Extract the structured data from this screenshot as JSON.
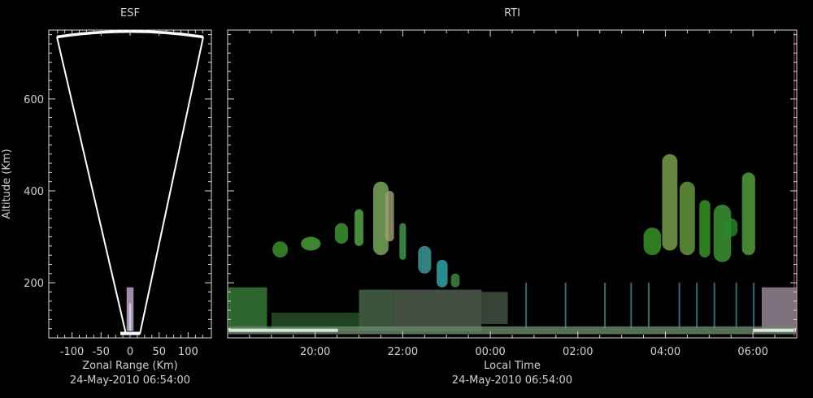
{
  "colors": {
    "background": "#000000",
    "axis": "#d8d8d8",
    "text": "#d0d0d0",
    "fan": "#ffffff",
    "right_edge": "#b06060"
  },
  "chart_data": [
    {
      "type": "scatter",
      "title": "ESF",
      "xlabel": "Zonal Range (Km)",
      "ylabel": "Altitude (Km)",
      "timestamp": "24-May-2010 06:54:00",
      "xlim": [
        -140,
        140
      ],
      "ylim": [
        80,
        750
      ],
      "x_ticks": [
        {
          "value": -100,
          "label": "-100"
        },
        {
          "value": -50,
          "label": "-50"
        },
        {
          "value": 0,
          "label": "0"
        },
        {
          "value": 50,
          "label": "50"
        },
        {
          "value": 100,
          "label": "100"
        }
      ],
      "y_ticks": [
        {
          "value": 200,
          "label": "200"
        },
        {
          "value": 400,
          "label": "400"
        },
        {
          "value": 600,
          "label": "600"
        }
      ],
      "beam_fan": {
        "apex": [
          0,
          88
        ],
        "left_edge": [
          -126,
          735
        ],
        "right_edge": [
          126,
          735
        ],
        "top_altitude": 745
      },
      "echo_column": {
        "x_range": [
          -6,
          6
        ],
        "y_range": [
          95,
          190
        ]
      }
    },
    {
      "type": "heatmap",
      "title": "RTI",
      "xlabel": "Local Time",
      "timestamp": "24-May-2010 06:54:00",
      "xlim": [
        18.0,
        31.0
      ],
      "ylim": [
        80,
        750
      ],
      "x_ticks": [
        {
          "value": 20,
          "label": "20:00"
        },
        {
          "value": 22,
          "label": "22:00"
        },
        {
          "value": 24,
          "label": "00:00"
        },
        {
          "value": 26,
          "label": "02:00"
        },
        {
          "value": 28,
          "label": "04:00"
        },
        {
          "value": 30,
          "label": "06:00"
        }
      ],
      "y_ticks": [
        200,
        400,
        600
      ],
      "plumes": [
        {
          "t": 19.2,
          "alt_low": 255,
          "alt_high": 290,
          "width": 0.35,
          "color": "#3a9a2a"
        },
        {
          "t": 19.9,
          "alt_low": 270,
          "alt_high": 300,
          "width": 0.45,
          "color": "#4aa83a"
        },
        {
          "t": 20.6,
          "alt_low": 285,
          "alt_high": 330,
          "width": 0.3,
          "color": "#3f9e35"
        },
        {
          "t": 21.0,
          "alt_low": 280,
          "alt_high": 360,
          "width": 0.2,
          "color": "#58b048"
        },
        {
          "t": 21.5,
          "alt_low": 260,
          "alt_high": 420,
          "width": 0.35,
          "color": "#7fb060"
        },
        {
          "t": 21.7,
          "alt_low": 290,
          "alt_high": 400,
          "width": 0.2,
          "color": "#a0a070"
        },
        {
          "t": 22.0,
          "alt_low": 250,
          "alt_high": 330,
          "width": 0.15,
          "color": "#40a050"
        },
        {
          "t": 22.5,
          "alt_low": 220,
          "alt_high": 280,
          "width": 0.3,
          "color": "#40a0a0"
        },
        {
          "t": 22.9,
          "alt_low": 190,
          "alt_high": 250,
          "width": 0.25,
          "color": "#30b0b0"
        },
        {
          "t": 23.2,
          "alt_low": 190,
          "alt_high": 220,
          "width": 0.2,
          "color": "#409040"
        },
        {
          "t": 27.7,
          "alt_low": 260,
          "alt_high": 320,
          "width": 0.4,
          "color": "#3a9a2a"
        },
        {
          "t": 28.1,
          "alt_low": 270,
          "alt_high": 480,
          "width": 0.35,
          "color": "#7fa850"
        },
        {
          "t": 28.5,
          "alt_low": 260,
          "alt_high": 420,
          "width": 0.35,
          "color": "#6aa040"
        },
        {
          "t": 28.9,
          "alt_low": 255,
          "alt_high": 380,
          "width": 0.25,
          "color": "#3a9a2a"
        },
        {
          "t": 29.3,
          "alt_low": 245,
          "alt_high": 370,
          "width": 0.4,
          "color": "#3f9e35"
        },
        {
          "t": 29.9,
          "alt_low": 260,
          "alt_high": 440,
          "width": 0.3,
          "color": "#58a840"
        },
        {
          "t": 29.5,
          "alt_low": 300,
          "alt_high": 340,
          "width": 0.3,
          "color": "#2a8a2a"
        }
      ],
      "low_layer": [
        {
          "t0": 18.0,
          "t1": 18.9,
          "alt_low": 95,
          "alt_high": 190,
          "color": "#3c8a3c"
        },
        {
          "t0": 19.0,
          "t1": 21.0,
          "alt_low": 95,
          "alt_high": 135,
          "color": "#2a5a2a"
        },
        {
          "t0": 21.0,
          "t1": 21.8,
          "alt_low": 95,
          "alt_high": 185,
          "color": "#4f704f"
        },
        {
          "t0": 21.8,
          "t1": 23.8,
          "alt_low": 95,
          "alt_high": 185,
          "color": "#5a6a55"
        },
        {
          "t0": 23.8,
          "t1": 24.4,
          "alt_low": 110,
          "alt_high": 180,
          "color": "#4a5a4a"
        },
        {
          "t0": 30.2,
          "t1": 31.0,
          "alt_low": 100,
          "alt_high": 190,
          "color": "#a898a8"
        }
      ]
    }
  ]
}
